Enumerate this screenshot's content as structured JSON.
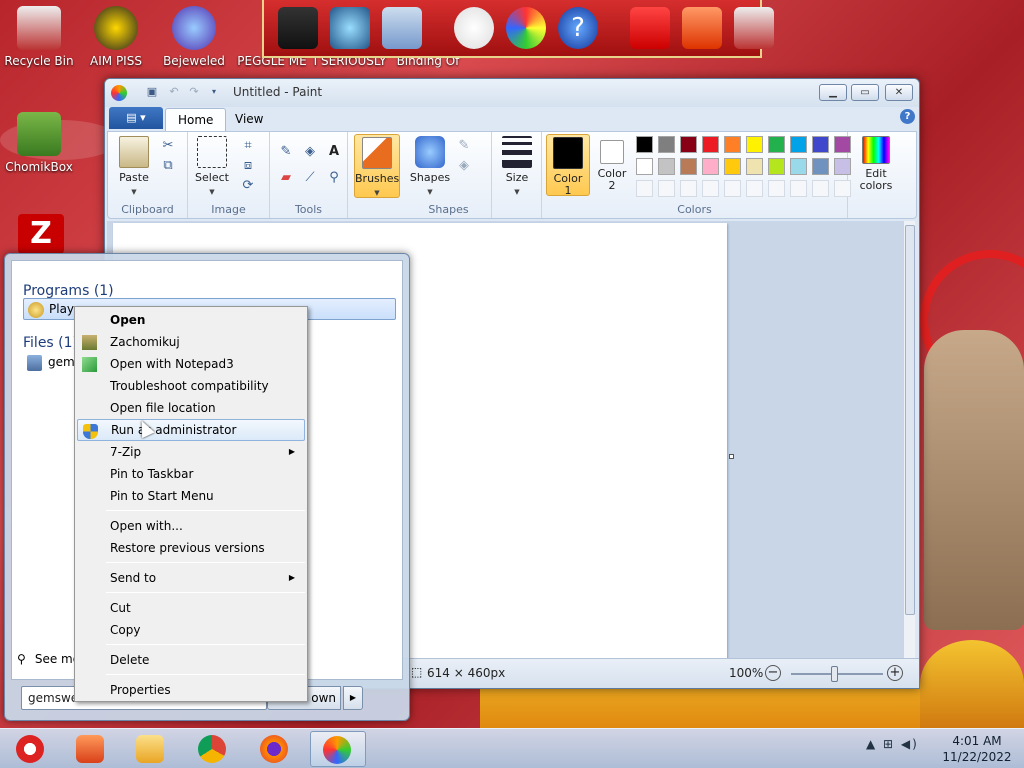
{
  "desktop": {
    "icons": [
      {
        "label": "Recycle Bin"
      },
      {
        "label": "AIM PISS"
      },
      {
        "label": "Bejeweled"
      },
      {
        "label": "PEGGLE ME"
      },
      {
        "label": "I SERIOUSLY"
      },
      {
        "label": "Binding Of"
      },
      {
        "label": "ChomikBox"
      }
    ]
  },
  "paint": {
    "title": "Untitled - Paint",
    "tabs": [
      "Home",
      "View"
    ],
    "groups": {
      "clipboard": "Clipboard",
      "image": "Image",
      "tools": "Tools",
      "shapes": "Shapes",
      "colors": "Colors"
    },
    "buttons": {
      "paste": "Paste",
      "select": "Select",
      "brushes": "Brushes",
      "shapes": "Shapes",
      "size": "Size",
      "color1_a": "Color",
      "color1_b": "1",
      "color2_a": "Color",
      "color2_b": "2",
      "edit_colors_a": "Edit",
      "edit_colors_b": "colors"
    },
    "palette": [
      "#000000",
      "#7f7f7f",
      "#880015",
      "#ed1c24",
      "#ff7f27",
      "#fff200",
      "#22b14c",
      "#00a2e8",
      "#3f48cc",
      "#a349a4",
      "#ffffff",
      "#c3c3c3",
      "#b97a57",
      "#ffaec9",
      "#ffc90e",
      "#efe4b0",
      "#b5e61d",
      "#99d9ea",
      "#7092be",
      "#c8bfe7"
    ],
    "color1": "#000000",
    "color2": "#ffffff",
    "status": {
      "dimensions": "614 × 460px",
      "zoom": "100%"
    }
  },
  "start_menu": {
    "programs_header": "Programs (1)",
    "program_item": "Play",
    "files_header": "Files (1)",
    "file_item": "gem",
    "see_more": "See mo",
    "search_value": "gemswe",
    "shutdown_label": "own"
  },
  "context_menu": {
    "items": [
      {
        "label": "Open",
        "bold": true
      },
      {
        "label": "Zachomikuj"
      },
      {
        "label": "Open with Notepad3"
      },
      {
        "label": "Troubleshoot compatibility"
      },
      {
        "label": "Open file location"
      },
      {
        "label": "Run as administrator",
        "hover": true
      },
      {
        "label": "7-Zip",
        "submenu": true
      },
      {
        "label": "Pin to Taskbar"
      },
      {
        "label": "Pin to Start Menu"
      },
      {
        "label": "Open with..."
      },
      {
        "label": "Restore previous versions"
      },
      {
        "label": "Send to",
        "submenu": true
      },
      {
        "label": "Cut"
      },
      {
        "label": "Copy"
      },
      {
        "label": "Delete"
      },
      {
        "label": "Properties"
      }
    ]
  },
  "taskbar": {
    "clock_time": "4:01 AM",
    "clock_date": "11/22/2022"
  },
  "colors": {
    "accent": "#2b579a",
    "desktop_red": "#c4383c"
  }
}
